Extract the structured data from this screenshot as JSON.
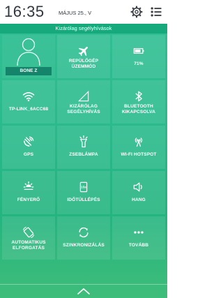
{
  "status_bar": {
    "time": "16:35",
    "date": "MÁJUS 25., V",
    "icons": [
      "gear-icon",
      "menu-list-icon"
    ]
  },
  "banner": {
    "text": "Kizárólag segélyhívások"
  },
  "profile": {
    "name": "BONE Z",
    "icon": "user-avatar-icon"
  },
  "tiles": [
    {
      "label": "REPÜLŐGÉP ÜZEMMÓD",
      "icon": "airplane-icon"
    },
    {
      "label": "71%",
      "icon": "battery-icon"
    },
    {
      "label": "TP-LINK_6ACC68",
      "icon": "wifi-icon"
    },
    {
      "label": "KIZÁRÓLAG SEGÉLYHÍVÁS",
      "icon": "signal-icon"
    },
    {
      "label": "BLUETOOTH KIKAPCSOLVA",
      "icon": "bluetooth-icon"
    },
    {
      "label": "GPS",
      "icon": "gps-icon"
    },
    {
      "label": "ZSEBLÁMPA",
      "icon": "flashlight-icon"
    },
    {
      "label": "WI-FI HOTSPOT",
      "icon": "hotspot-icon"
    },
    {
      "label": "FÉNYERŐ",
      "icon": "brightness-icon"
    },
    {
      "label": "IDŐTÚLLÉPÉS",
      "icon": "timeout-icon"
    },
    {
      "label": "HANG",
      "icon": "speaker-icon"
    },
    {
      "label": "AUTOMATIKUS ELFORGATÁS",
      "icon": "rotate-icon"
    },
    {
      "label": "SZINKRONIZÁLÁS",
      "icon": "sync-icon"
    },
    {
      "label": "TOVÁBB",
      "icon": "more-icon"
    }
  ],
  "bottom": {
    "icon": "chevron-up-icon"
  },
  "colors": {
    "panel": "#29b98b",
    "banner": "#16a97c",
    "name_bar": "#14856a",
    "text": "#ffffff"
  }
}
